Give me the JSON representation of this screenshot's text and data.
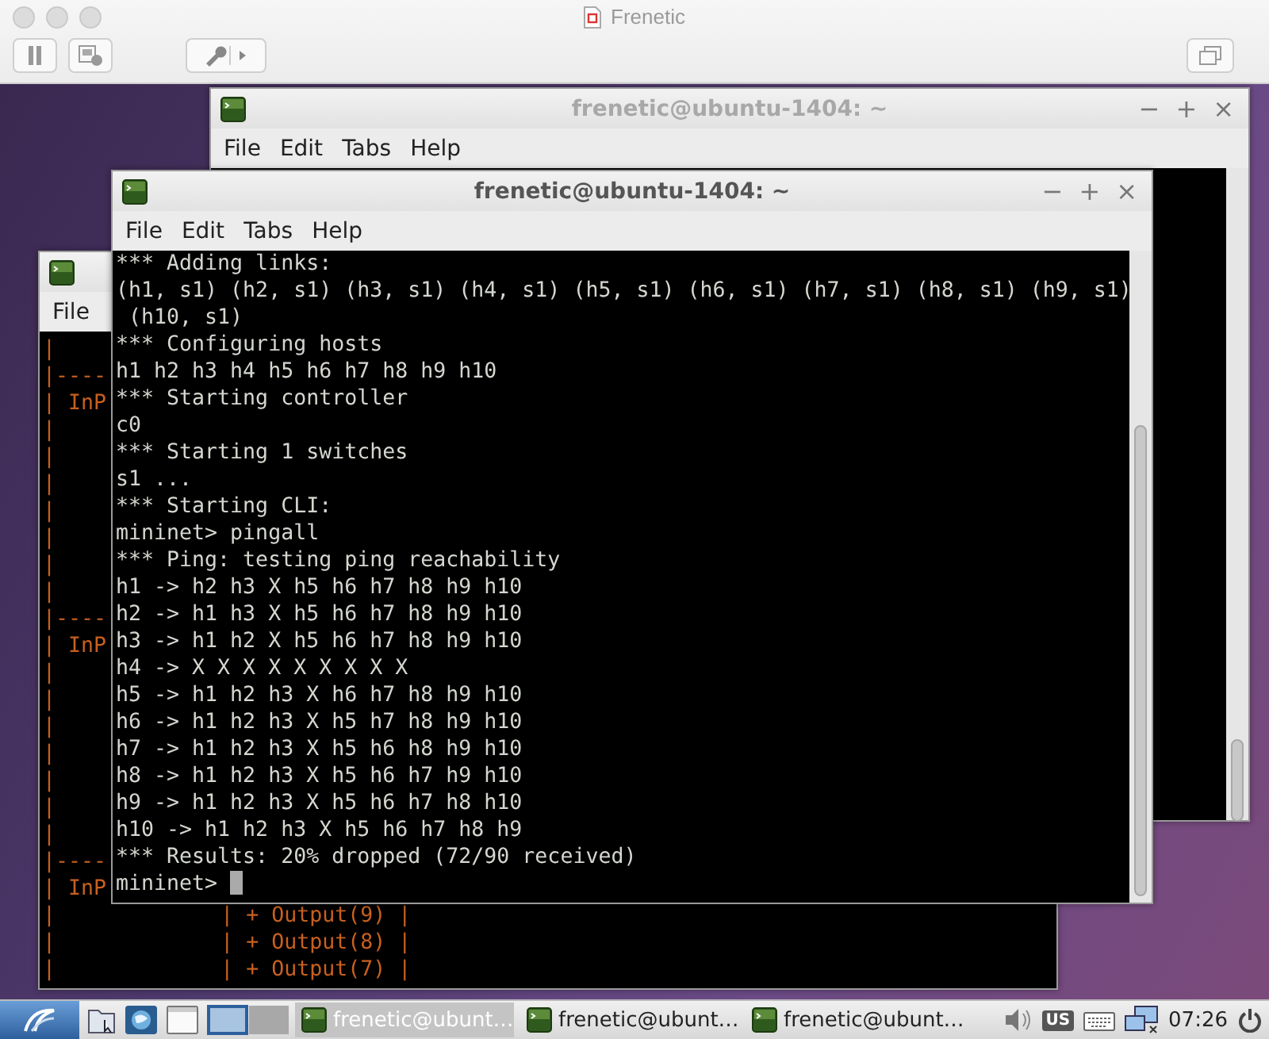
{
  "host_window": {
    "title": "Frenetic"
  },
  "windows": [
    {
      "title": "frenetic@ubuntu-1404: ~",
      "active": false,
      "controls": [
        "−",
        "+",
        "×"
      ],
      "menu": [
        "File",
        "Edit",
        "Tabs",
        "Help"
      ]
    },
    {
      "menu": [
        "File"
      ],
      "lines": [
        "|",
        "|----",
        "| InP",
        "|",
        "|",
        "|",
        "|",
        "|",
        "|",
        "|",
        "|----",
        "| InP",
        "|",
        "|",
        "|",
        "|",
        "|",
        "|",
        "|",
        "|----",
        "| InP",
        "|             | + Output(9) |",
        "|             | + Output(8) |",
        "|             | + Output(7) |"
      ]
    },
    {
      "title": "frenetic@ubuntu-1404: ~",
      "active": true,
      "controls": [
        "−",
        "+",
        "×"
      ],
      "menu": [
        "File",
        "Edit",
        "Tabs",
        "Help"
      ],
      "lines": [
        "*** Adding links:",
        "(h1, s1) (h2, s1) (h3, s1) (h4, s1) (h5, s1) (h6, s1) (h7, s1) (h8, s1) (h9, s1)",
        " (h10, s1)",
        "*** Configuring hosts",
        "h1 h2 h3 h4 h5 h6 h7 h8 h9 h10",
        "*** Starting controller",
        "c0",
        "*** Starting 1 switches",
        "s1 ...",
        "*** Starting CLI:",
        "mininet> pingall",
        "*** Ping: testing ping reachability",
        "h1 -> h2 h3 X h5 h6 h7 h8 h9 h10",
        "h2 -> h1 h3 X h5 h6 h7 h8 h9 h10",
        "h3 -> h1 h2 X h5 h6 h7 h8 h9 h10",
        "h4 -> X X X X X X X X X",
        "h5 -> h1 h2 h3 X h6 h7 h8 h9 h10",
        "h6 -> h1 h2 h3 X h5 h7 h8 h9 h10",
        "h7 -> h1 h2 h3 X h5 h6 h8 h9 h10",
        "h8 -> h1 h2 h3 X h5 h6 h7 h9 h10",
        "h9 -> h1 h2 h3 X h5 h6 h7 h8 h10",
        "h10 -> h1 h2 h3 X h5 h6 h7 h8 h9",
        "*** Results: 20% dropped (72/90 received)",
        "mininet> "
      ],
      "cursor": true
    }
  ],
  "taskbar": {
    "tasks": [
      {
        "label": "frenetic@ubunt…",
        "selected": true
      },
      {
        "label": "frenetic@ubunt…",
        "selected": false
      },
      {
        "label": "frenetic@ubunt…",
        "selected": false
      }
    ],
    "keyboard_layout": "US",
    "clock": "07:26"
  }
}
